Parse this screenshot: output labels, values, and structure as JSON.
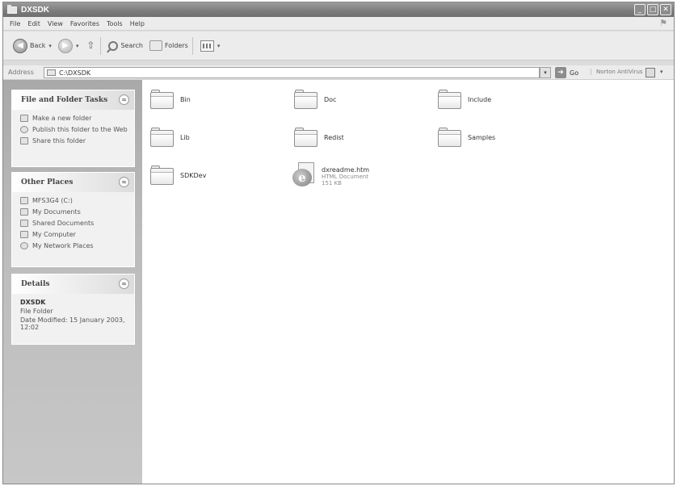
{
  "window": {
    "title": "DXSDK"
  },
  "menu": [
    "File",
    "Edit",
    "View",
    "Favorites",
    "Tools",
    "Help"
  ],
  "toolbar": {
    "back_label": "Back",
    "search_label": "Search",
    "folders_label": "Folders"
  },
  "address": {
    "label": "Address",
    "value": "C:\\DXSDK",
    "go_label": "Go",
    "norton_label": "Norton AntiVirus"
  },
  "panels": {
    "file_tasks": {
      "title": "File and Folder Tasks",
      "items": [
        "Make a new folder",
        "Publish this folder to the Web",
        "Share this folder"
      ]
    },
    "other_places": {
      "title": "Other Places",
      "items": [
        "MFS3G4 (C:)",
        "My Documents",
        "Shared Documents",
        "My Computer",
        "My Network Places"
      ]
    },
    "details": {
      "title": "Details",
      "name": "DXSDK",
      "type": "File Folder",
      "modified": "Date Modified: 15 January 2003, 12:02"
    }
  },
  "items": [
    {
      "name": "Bin",
      "kind": "folder"
    },
    {
      "name": "Doc",
      "kind": "folder"
    },
    {
      "name": "Include",
      "kind": "folder"
    },
    {
      "name": "Lib",
      "kind": "folder"
    },
    {
      "name": "Redist",
      "kind": "folder"
    },
    {
      "name": "Samples",
      "kind": "folder"
    },
    {
      "name": "SDKDev",
      "kind": "folder"
    },
    {
      "name": "dxreadme.htm",
      "kind": "file",
      "type": "HTML Document",
      "size": "151 KB"
    }
  ]
}
